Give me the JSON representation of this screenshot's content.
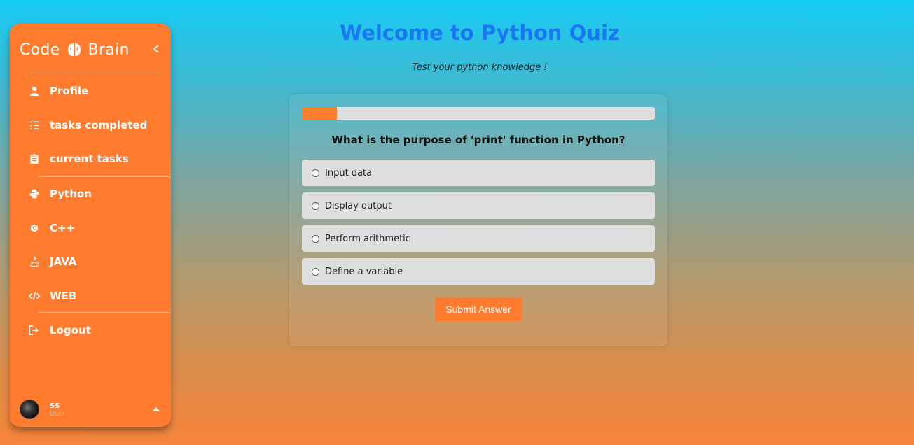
{
  "sidebar": {
    "brand_left": "Code",
    "brand_right": "Brain",
    "items": [
      {
        "label": "Profile",
        "icon": "user-icon"
      },
      {
        "label": "tasks completed",
        "icon": "list-check-icon"
      },
      {
        "label": "current tasks",
        "icon": "clipboard-icon"
      },
      {
        "label": "Python",
        "icon": "python-icon"
      },
      {
        "label": "C++",
        "icon": "cpp-icon"
      },
      {
        "label": "JAVA",
        "icon": "java-icon"
      },
      {
        "label": "WEB",
        "icon": "code-icon"
      },
      {
        "label": "Logout",
        "icon": "logout-icon"
      }
    ],
    "user": {
      "name": "ss",
      "role": "User"
    }
  },
  "main": {
    "title": "Welcome to Python Quiz",
    "subtitle": "Test your python knowledge !",
    "progress_fraction": 0.1,
    "question": "What is the purpose of 'print' function in Python?",
    "options": [
      "Input data",
      "Display output",
      "Perform arithmetic",
      "Define a variable"
    ],
    "submit_label": "Submit Answer"
  },
  "colors": {
    "accent": "#ff7b2d",
    "title": "#1877f2",
    "option_bg": "#dedede"
  }
}
